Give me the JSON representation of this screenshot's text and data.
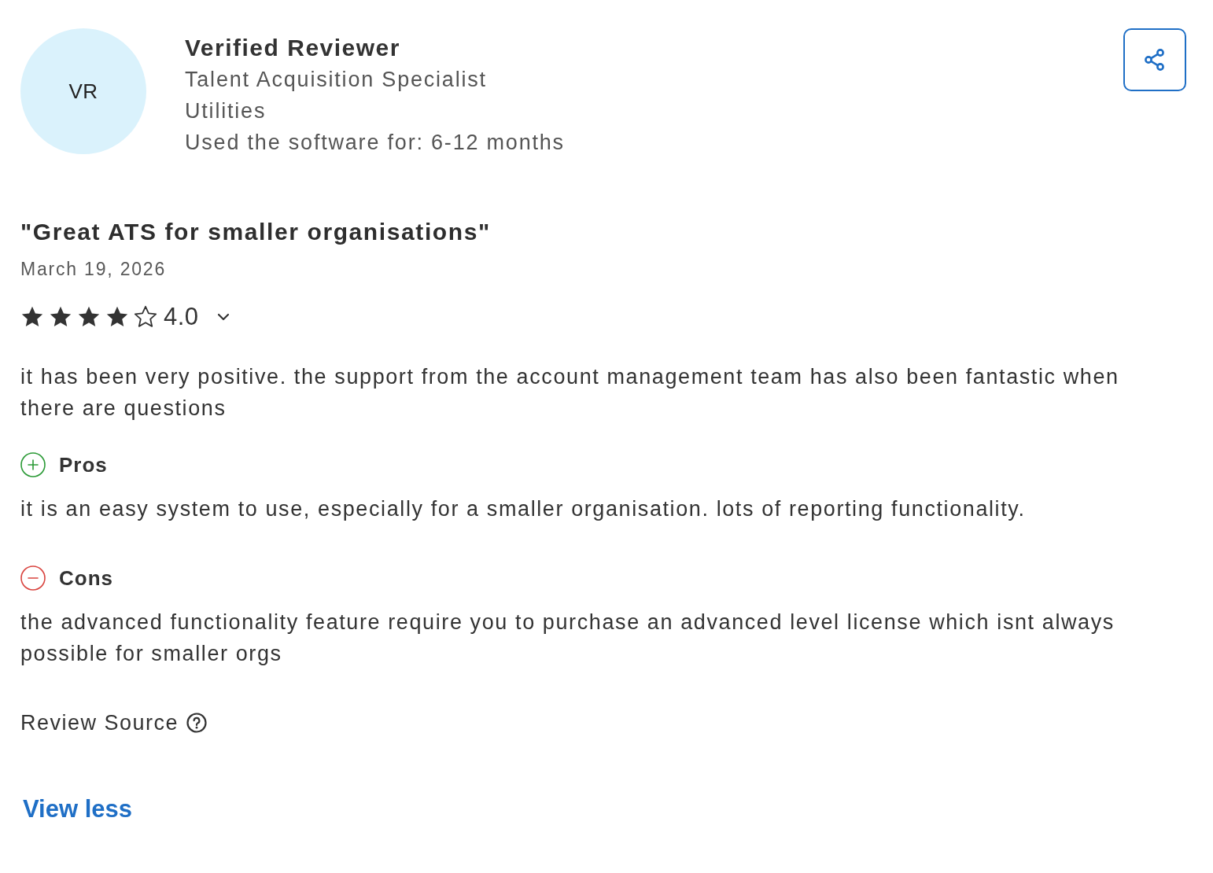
{
  "reviewer": {
    "initials": "VR",
    "name": "Verified Reviewer",
    "job_title": "Talent Acquisition Specialist",
    "industry": "Utilities",
    "usage": "Used the software for: 6-12 months"
  },
  "review": {
    "title": "\"Great ATS for smaller organisations\"",
    "date": "March 19, 2026",
    "stars": 4,
    "rating": "4.0",
    "summary": "it has been very positive. the support from the account management team has also been fantastic when there are questions",
    "sections": [
      {
        "kind": "pros",
        "heading": "Pros",
        "text": "it is an easy system to use, especially for a smaller organisation. lots of reporting functionality."
      },
      {
        "kind": "cons",
        "heading": "Cons",
        "text": "the advanced functionality feature require you to purchase an advanced level license which isnt always possible for smaller orgs"
      }
    ],
    "source_label": "Review Source"
  },
  "view_less_link": "View less"
}
